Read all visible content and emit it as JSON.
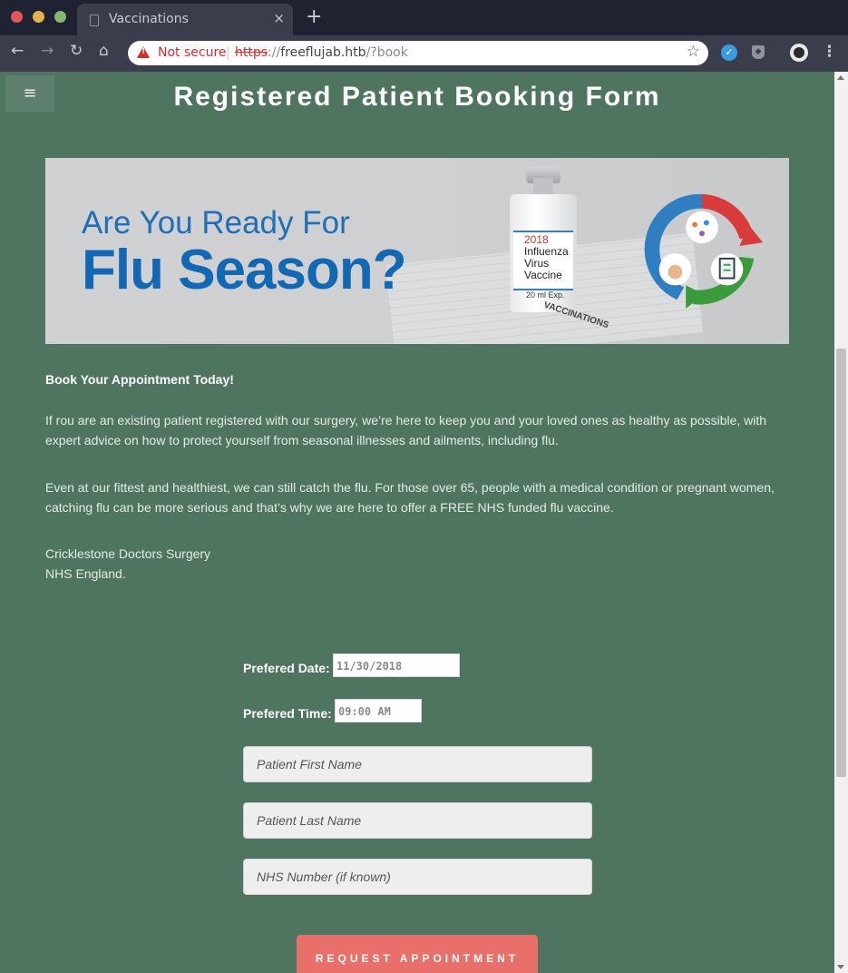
{
  "browser": {
    "tab_title": "Vaccinations",
    "tab_close": "×",
    "new_tab": "+",
    "security_label": "Not secure",
    "url_scheme": "https",
    "url_sep": "://",
    "url_host": "freeflujab.htb",
    "url_path": "/?book",
    "window_controls": {
      "close": "#e0565b",
      "minimize": "#e2b24d",
      "maximize": "#85b56f"
    },
    "icons": [
      "back-icon",
      "forward-icon",
      "reload-icon",
      "home-icon",
      "warning-icon",
      "star-icon",
      "extension-icon",
      "shield-extension-icon",
      "profile-icon",
      "menu-icon"
    ]
  },
  "page": {
    "menu_glyph": "≡",
    "title": "Registered Patient Booking Form",
    "banner": {
      "line1": "Are You Ready For",
      "line2": "Flu Season?",
      "vial_year": "2018",
      "vial_line1": "Influenza",
      "vial_line2": "Virus",
      "vial_line3": "Vaccine",
      "vial_ml": "20 ml  Exp.",
      "sheet_label": "VACCINATIONS"
    },
    "heading": "Book Your Appointment Today!",
    "para1": "If rou are an existing patient registered with our surgery, we’re here to keep you and your loved ones as healthy as possible, with expert advice on how to protect yourself from seasonal illnesses and ailments, including flu.",
    "para2": "Even at our fittest and healthiest, we can still catch the flu. For those over 65, people with a medical condition or pregnant women, catching flu can be more serious and that’s why we are here to offer a FREE NHS funded flu vaccine.",
    "address_line1": "Cricklestone Doctors Surgery",
    "address_line2": "NHS England."
  },
  "form": {
    "date_label": "Prefered Date:",
    "date_value": "11/30/2018",
    "time_label": "Prefered Time:",
    "time_value": "09:00 AM",
    "first_name_placeholder": "Patient First Name",
    "last_name_placeholder": "Patient Last Name",
    "nhs_placeholder": "NHS Number (if known)",
    "submit_label": "REQUEST APPOINTMENT"
  },
  "colors": {
    "page_bg": "#4f7560",
    "button": "#e9706a",
    "banner_blue": "#1268b3",
    "warning_red": "#d22e2e"
  }
}
